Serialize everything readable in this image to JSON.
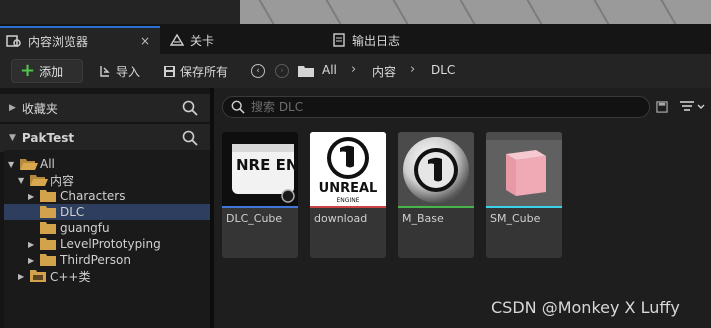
{
  "tabs": [
    {
      "label": "内容浏览器",
      "active": true,
      "icon": "content-browser-icon"
    },
    {
      "label": "关卡",
      "active": false,
      "icon": "level-icon"
    },
    {
      "label": "输出日志",
      "active": false,
      "icon": "output-log-icon"
    }
  ],
  "tab_close_label": "×",
  "toolbar": {
    "add_label": "添加",
    "import_label": "导入",
    "save_all_label": "保存所有"
  },
  "breadcrumb": [
    "All",
    "内容",
    "DLC"
  ],
  "left_panel": {
    "favorites_label": "收藏夹",
    "project_label": "PakTest",
    "tree": [
      {
        "label": "All",
        "level": 0,
        "expanded": true,
        "selected": false
      },
      {
        "label": "内容",
        "level": 1,
        "expanded": true,
        "selected": false
      },
      {
        "label": "Characters",
        "level": 2,
        "expanded": false,
        "selected": false
      },
      {
        "label": "DLC",
        "level": 2,
        "expanded": false,
        "selected": true
      },
      {
        "label": "guangfu",
        "level": 2,
        "expanded": false,
        "selected": false
      },
      {
        "label": "LevelPrototyping",
        "level": 2,
        "expanded": false,
        "selected": false
      },
      {
        "label": "ThirdPerson",
        "level": 2,
        "expanded": false,
        "selected": false
      },
      {
        "label": "C++类",
        "level": 0,
        "expanded": false,
        "selected": false
      }
    ]
  },
  "search": {
    "placeholder": "搜索 DLC",
    "value": ""
  },
  "assets": [
    {
      "name": "DLC_Cube",
      "color": "#3f76d8"
    },
    {
      "name": "download",
      "color": "#c94545"
    },
    {
      "name": "M_Base",
      "color": "#47b54a"
    },
    {
      "name": "SM_Cube",
      "color": "#3ad2e8"
    }
  ],
  "thumb_text": {
    "cube_logo": "NRE ENGI",
    "unreal_line1": "UNREAL",
    "unreal_line2": "ENGINE"
  },
  "watermark": "CSDN @Monkey X Luffy"
}
